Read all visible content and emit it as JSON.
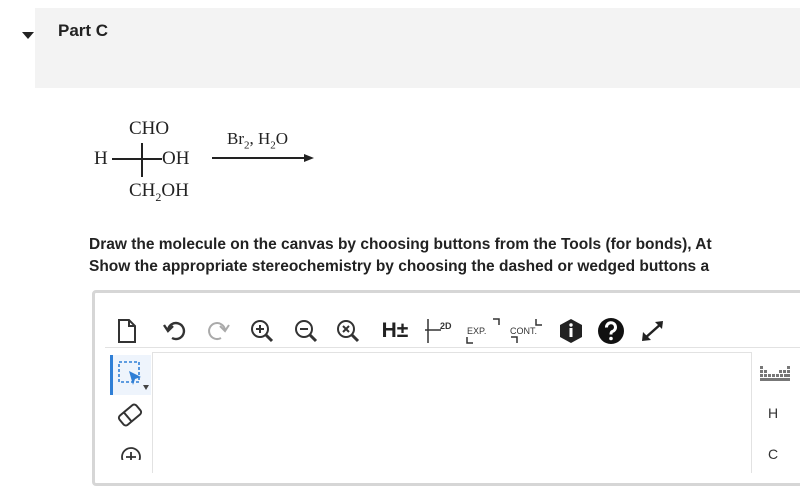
{
  "part": {
    "title": "Part C"
  },
  "reaction": {
    "top_group": "CHO",
    "left_substituent": "H",
    "right_substituent": "OH",
    "bottom_group_main": "CH",
    "bottom_group_sub": "2",
    "bottom_group_tail": "OH",
    "reagent_a": "Br",
    "reagent_a_sub": "2",
    "reagent_sep": ", H",
    "reagent_b_sub": "2",
    "reagent_b_tail": "O"
  },
  "instructions": {
    "line1": "Draw the molecule on the canvas by choosing buttons from the Tools (for bonds), At",
    "line2": "Show the appropriate stereochemistry by choosing the dashed or wedged buttons a"
  },
  "toolbar": {
    "h_toggle": "H±",
    "label_2d": "2D",
    "label_exp": "EXP.",
    "label_cont": "CONT."
  },
  "atom_panel": {
    "atoms": [
      "H",
      "C"
    ]
  },
  "colors": {
    "accent": "#2f7fd6",
    "header_bg": "#f3f3f3",
    "border": "#d6d6d6"
  }
}
